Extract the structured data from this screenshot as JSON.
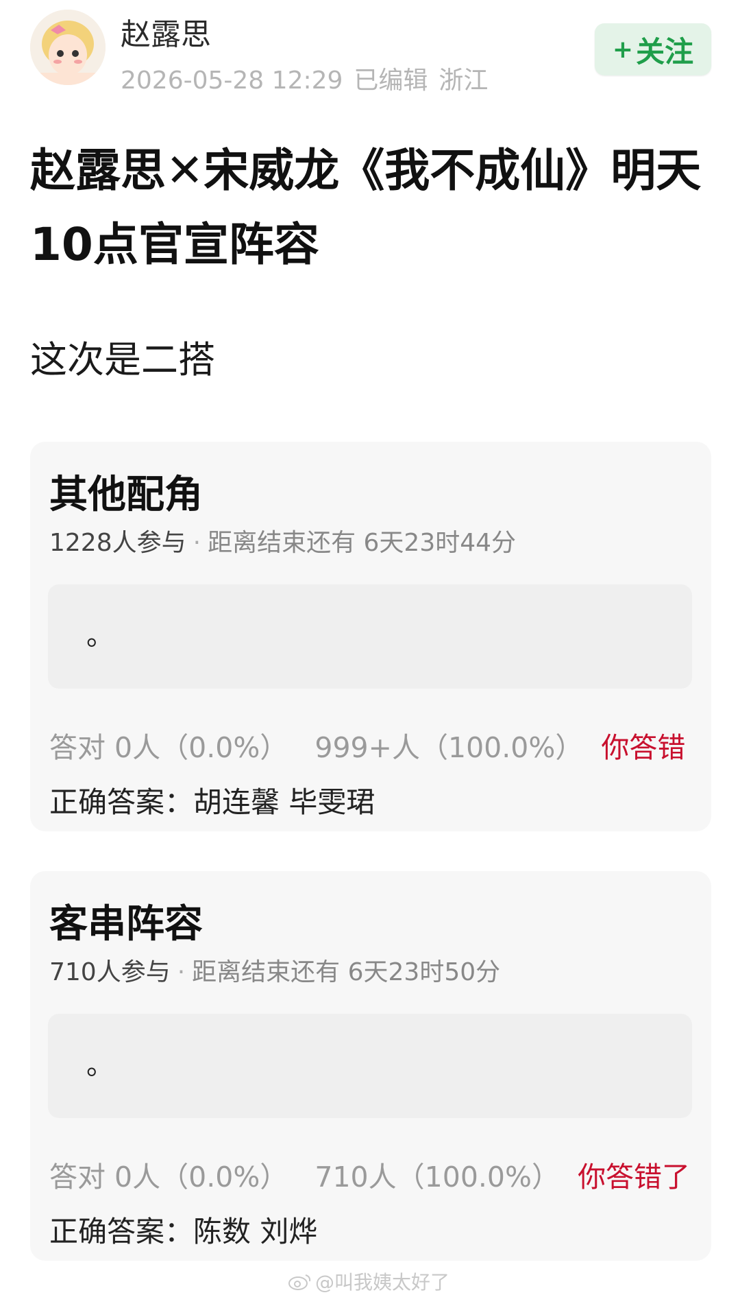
{
  "header": {
    "username": "赵露思",
    "date": "2026-05-28 12:29",
    "edited": "已编辑",
    "location": "浙江",
    "follow_plus": "+",
    "follow_label": "关注"
  },
  "post": {
    "title": "赵露思✕宋威龙《我不成仙》明天10点官宣阵容",
    "body": "这次是二搭"
  },
  "polls": [
    {
      "title": "其他配角",
      "participants": "1228人参与",
      "separator": "·",
      "remaining": "距离结束还有 6天23时44分",
      "option_text": "。",
      "correct_stat": "答对 0人（0.0%）",
      "other_stat": "999+人（100.0%）",
      "result": "你答错",
      "answer_label": "正确答案：",
      "answer_value": "胡连馨 毕雯珺"
    },
    {
      "title": "客串阵容",
      "participants": "710人参与",
      "separator": "·",
      "remaining": "距离结束还有 6天23时50分",
      "option_text": "。",
      "correct_stat": "答对 0人（0.0%）",
      "other_stat": "710人（100.0%）",
      "result": "你答错了",
      "answer_label": "正确答案：",
      "answer_value": "陈数 刘烨"
    }
  ],
  "watermark": "@叫我姨太好了",
  "colors": {
    "follow_bg": "#e4f3e8",
    "follow_text": "#1f9e4a",
    "wrong": "#c8102e",
    "card_bg": "#f7f7f7"
  }
}
